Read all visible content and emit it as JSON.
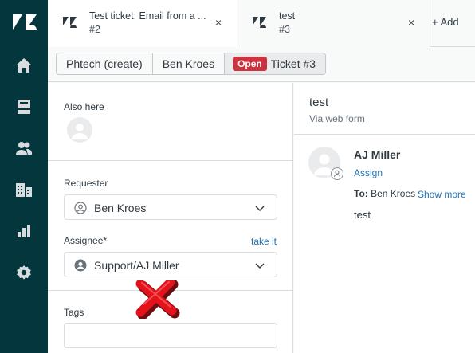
{
  "colors": {
    "nav_bg": "#03363d",
    "status_open": "#cc3340",
    "link": "#1f73b7",
    "error_mark": "#e3121b"
  },
  "tabs": [
    {
      "title": "Test ticket: Email from a ...",
      "subtitle": "#2",
      "close": "×",
      "icon": "zendesk-logo-icon"
    },
    {
      "title": "test",
      "subtitle": "#3",
      "close": "×",
      "icon": "zendesk-logo-icon"
    }
  ],
  "add_tab_label": "+ Add",
  "breadcrumb": {
    "org": "Phtech (create)",
    "user": "Ben Kroes",
    "status": "Open",
    "ticket": "Ticket #3"
  },
  "sidebar_nav": [
    "home-icon",
    "views-icon",
    "customers-icon",
    "organizations-icon",
    "reporting-icon",
    "admin-icon"
  ],
  "properties": {
    "also_here_label": "Also here",
    "requester_label": "Requester",
    "requester_value": "Ben Kroes",
    "assignee_label": "Assignee*",
    "take_it": "take it",
    "assignee_value": "Support/AJ Miller",
    "tags_label": "Tags"
  },
  "conversation": {
    "title": "test",
    "subtitle": "Via web form",
    "author": "AJ Miller",
    "assign": "Assign",
    "to_label": "To:",
    "to_value": " Ben Kroes",
    "show_more": "Show more",
    "body": "test"
  }
}
